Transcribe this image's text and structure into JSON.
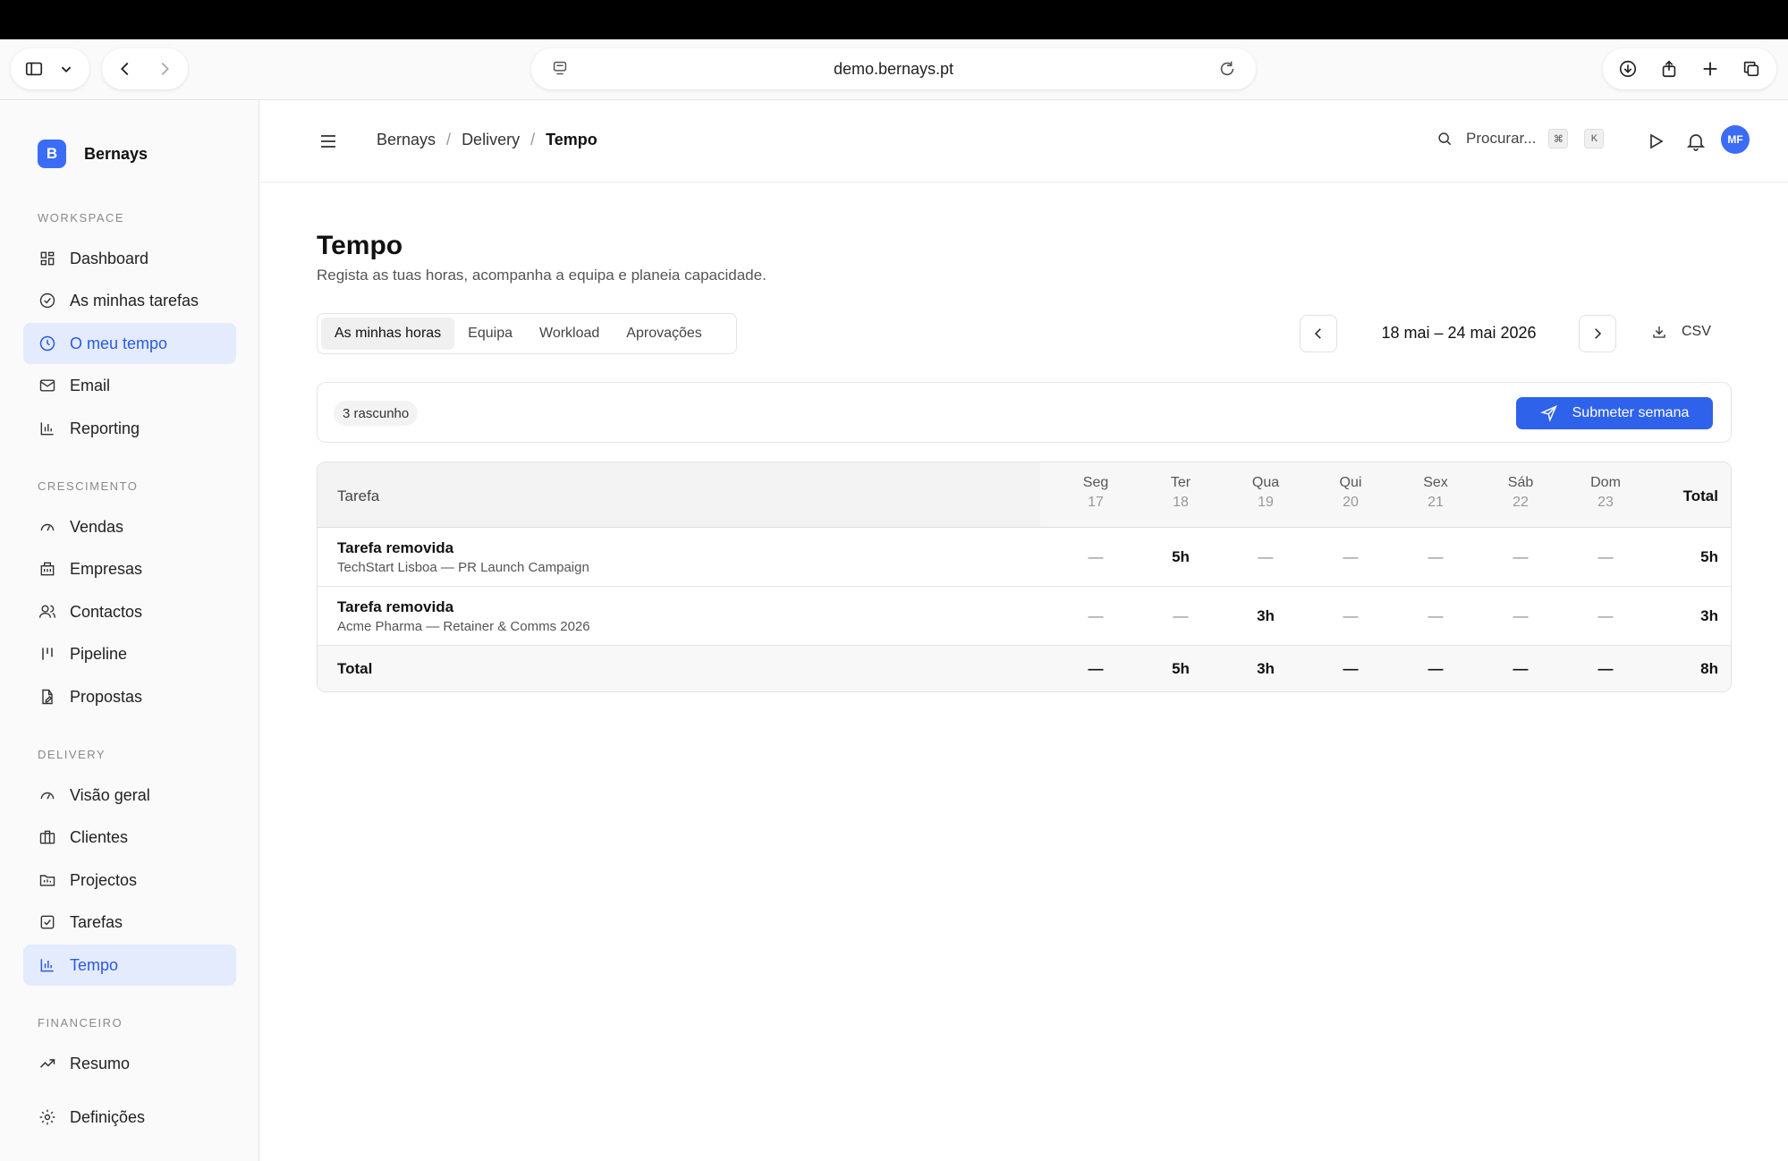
{
  "browser": {
    "url": "demo.bernays.pt"
  },
  "sidebar": {
    "brand": {
      "initial": "B",
      "name": "Bernays"
    },
    "sections": [
      {
        "label": "WORKSPACE",
        "items": [
          {
            "label": "Dashboard",
            "icon": "grid-icon"
          },
          {
            "label": "As minhas tarefas",
            "icon": "check-circle-icon"
          },
          {
            "label": "O meu tempo",
            "icon": "clock-icon",
            "active": true
          },
          {
            "label": "Email",
            "icon": "mail-icon"
          },
          {
            "label": "Reporting",
            "icon": "bar-chart-icon"
          }
        ]
      },
      {
        "label": "CRESCIMENTO",
        "items": [
          {
            "label": "Vendas",
            "icon": "gauge-icon"
          },
          {
            "label": "Empresas",
            "icon": "building-icon"
          },
          {
            "label": "Contactos",
            "icon": "users-icon"
          },
          {
            "label": "Pipeline",
            "icon": "pipeline-icon"
          },
          {
            "label": "Propostas",
            "icon": "file-edit-icon"
          }
        ]
      },
      {
        "label": "DELIVERY",
        "items": [
          {
            "label": "Visão geral",
            "icon": "gauge-icon"
          },
          {
            "label": "Clientes",
            "icon": "briefcase-icon"
          },
          {
            "label": "Projectos",
            "icon": "folder-icon"
          },
          {
            "label": "Tarefas",
            "icon": "checkbox-icon"
          },
          {
            "label": "Tempo",
            "icon": "bar-chart-icon",
            "active": true
          }
        ]
      },
      {
        "label": "FINANCEIRO",
        "items": [
          {
            "label": "Resumo",
            "icon": "trend-icon"
          }
        ]
      }
    ],
    "settings": {
      "label": "Definições",
      "icon": "gear-icon"
    }
  },
  "header": {
    "breadcrumb": [
      "Bernays",
      "Delivery",
      "Tempo"
    ],
    "search_placeholder": "Procurar...",
    "kbd": [
      "⌘",
      "K"
    ],
    "avatar": "MF"
  },
  "page": {
    "title": "Tempo",
    "subtitle": "Regista as tuas horas, acompanha a equipa e planeia capacidade.",
    "tabs": [
      "As minhas horas",
      "Equipa",
      "Workload",
      "Aprovações"
    ],
    "date_range": "18 mai – 24 mai 2026",
    "csv_label": "CSV",
    "status_badge": "3 rascunho",
    "submit_label": "Submeter semana"
  },
  "table": {
    "task_header": "Tarefa",
    "total_header": "Total",
    "days": [
      {
        "name": "Seg",
        "date": "17"
      },
      {
        "name": "Ter",
        "date": "18"
      },
      {
        "name": "Qua",
        "date": "19"
      },
      {
        "name": "Qui",
        "date": "20"
      },
      {
        "name": "Sex",
        "date": "21"
      },
      {
        "name": "Sáb",
        "date": "22"
      },
      {
        "name": "Dom",
        "date": "23"
      }
    ],
    "rows": [
      {
        "title": "Tarefa removida",
        "subtitle": "TechStart Lisboa — PR Launch Campaign",
        "values": [
          "—",
          "5h",
          "—",
          "—",
          "—",
          "—",
          "—"
        ],
        "total": "5h"
      },
      {
        "title": "Tarefa removida",
        "subtitle": "Acme Pharma — Retainer & Comms 2026",
        "values": [
          "—",
          "—",
          "3h",
          "—",
          "—",
          "—",
          "—"
        ],
        "total": "3h"
      }
    ],
    "totals": {
      "label": "Total",
      "values": [
        "—",
        "5h",
        "3h",
        "—",
        "—",
        "—",
        "—"
      ],
      "total": "8h"
    }
  }
}
